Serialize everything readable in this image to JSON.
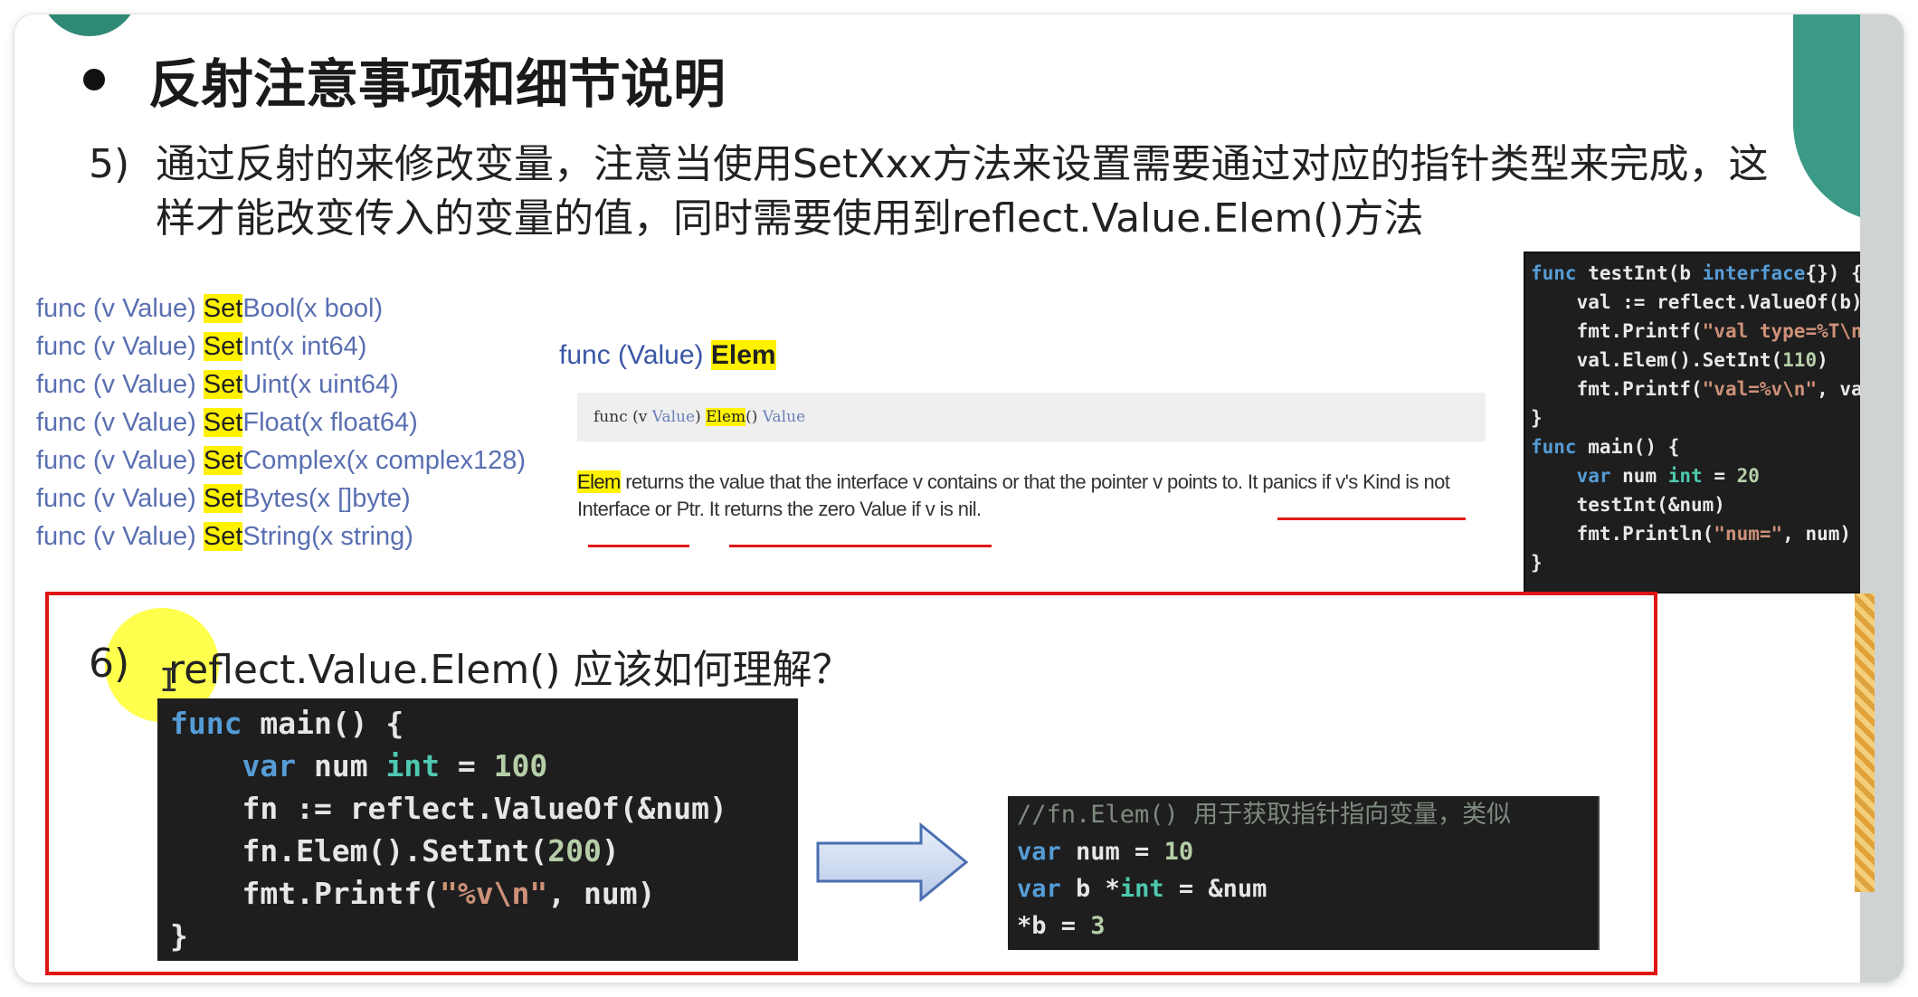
{
  "slide": {
    "title": "反射注意事项和细节说明",
    "item5": {
      "number": "5)",
      "text": "通过反射的来修改变量，注意当使用SetXxx方法来设置需要通过对应的指针类型来完成，这样才能改变传入的变量的值，同时需要使用到reflect.Value.Elem()方法"
    },
    "setters": [
      {
        "prefix": "func (v Value) ",
        "hl": "Set",
        "rest": "Bool(x bool)"
      },
      {
        "prefix": "func (v Value) ",
        "hl": "Set",
        "rest": "Int(x int64)"
      },
      {
        "prefix": "func (v Value) ",
        "hl": "Set",
        "rest": "Uint(x uint64)"
      },
      {
        "prefix": "func (v Value) ",
        "hl": "Set",
        "rest": "Float(x float64)"
      },
      {
        "prefix": "func (v Value) ",
        "hl": "Set",
        "rest": "Complex(x complex128)"
      },
      {
        "prefix": "func (v Value) ",
        "hl": "Set",
        "rest": "Bytes(x []byte)"
      },
      {
        "prefix": "func (v Value) ",
        "hl": "Set",
        "rest": "String(x string)"
      }
    ],
    "elem_doc": {
      "title_prefix": "func (Value) ",
      "title_hl": "Elem",
      "signature_func": "func (v ",
      "signature_type": "Value",
      "signature_mid": ") ",
      "signature_hl": "Elem",
      "signature_paren": "() ",
      "signature_ret": "Value",
      "desc_hl": "Elem",
      "desc_rest": " returns the value that the interface v contains or that the pointer v points to. It panics if v's Kind is not Interface or Ptr. It returns the zero Value if v is nil."
    },
    "item6": {
      "number": "6)",
      "text": "reflect.Value.Elem() 应该如何理解？",
      "cursor": "I"
    },
    "code_right": [
      "func testInt(b interface{}) {",
      "    val := reflect.ValueOf(b)",
      "    fmt.Printf(\"val type=%T\\n\",",
      "    val.Elem().SetInt(110)",
      "    fmt.Printf(\"val=%v\\n\", val)",
      "}",
      "func main() {",
      "    var num int = 20",
      "    testInt(&num)",
      "    fmt.Println(\"num=\", num)",
      "}"
    ],
    "code_main": [
      "func main() {",
      "    var num int = 100",
      "    fn := reflect.ValueOf(&num)",
      "    fn.Elem().SetInt(200)",
      "    fmt.Printf(\"%v\\n\", num)",
      "}"
    ],
    "code_analogy": [
      "//fn.Elem() 用于获取指针指向变量，类似",
      "var num = 10",
      "var b *int = &num",
      "*b = 3"
    ],
    "colors": {
      "highlight": "#fff200",
      "red_box": "#e01414",
      "code_bg": "#1e1e1e",
      "keyword": "#569cd6",
      "type": "#4ec9b0",
      "string": "#ce9178"
    }
  }
}
